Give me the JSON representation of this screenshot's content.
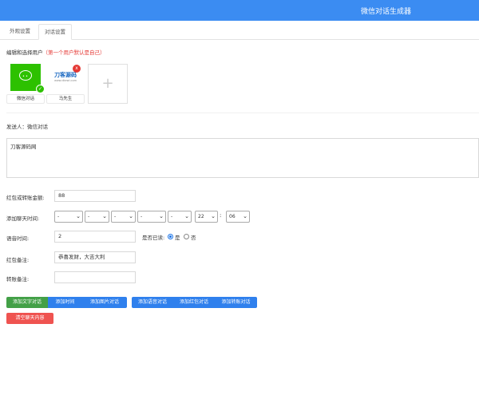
{
  "header": {
    "title": "微信对话生成器",
    "color": "#3b8cf2"
  },
  "tabs": [
    {
      "label": "外观设置"
    },
    {
      "label": "对话设置"
    }
  ],
  "users": {
    "label": "编辑和选择用户",
    "hint": "（第一个用户默认是自己）",
    "list": [
      {
        "name": "微信对话",
        "selected": true
      },
      {
        "name": "马先生",
        "logo_text": "刀客源码",
        "logo_sub": "www.dkewl.com"
      }
    ],
    "add_label": "+",
    "delete_label": "x",
    "check_label": "✓"
  },
  "sender": {
    "text": "发送人：微信对话"
  },
  "message": {
    "value": "刀客源码网"
  },
  "form": {
    "redpacket_label": "红包或转账金额:",
    "redpacket_value": "88",
    "time_label": "添加聊天时间:",
    "time_selects": [
      "-",
      "-",
      "-",
      "-",
      "-"
    ],
    "hour": "22",
    "time_colon": ":",
    "minute": "06",
    "voice_label": "语音时间:",
    "voice_value": "2",
    "read_label": "是否已读:",
    "read_yes": "是",
    "read_no": "否",
    "read_selected": "是",
    "remark_label": "红包备注:",
    "remark_value": "恭喜发财，大吉大利",
    "transfer_label": "转账备注:",
    "transfer_value": ""
  },
  "buttons": {
    "add_text": "添加文字对话",
    "add_time": "添加时间",
    "add_image": "添加图片对话",
    "add_voice": "添加语音对话",
    "add_redpacket": "添加红包对话",
    "add_transfer": "添加转账对话",
    "clear": "清空聊天内容"
  }
}
